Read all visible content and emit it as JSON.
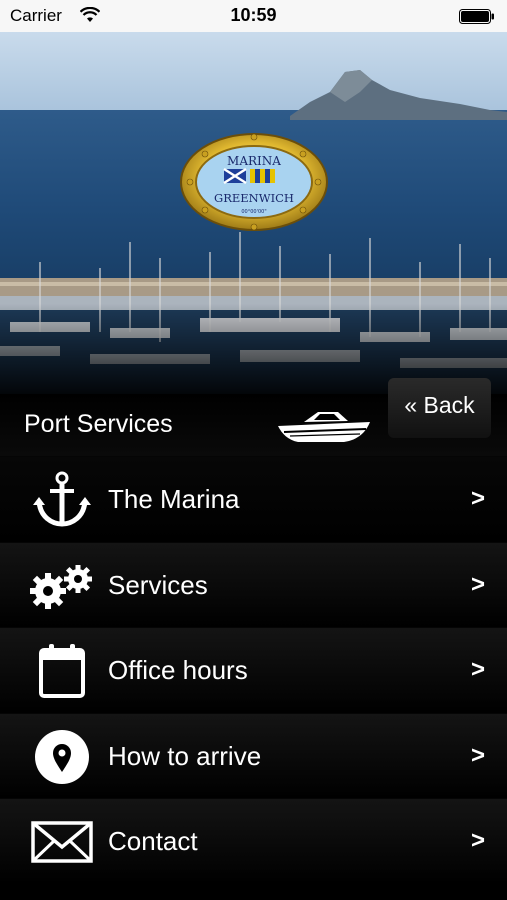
{
  "status_bar": {
    "carrier": "Carrier",
    "time": "10:59"
  },
  "hero": {
    "logo_top_text": "MARINA",
    "logo_bottom_text": "GREENWICH",
    "logo_sub_text": "00°00'00\""
  },
  "header": {
    "title": "Port Services",
    "back_label": "« Back"
  },
  "menu": {
    "items": [
      {
        "label": "The Marina",
        "icon": "anchor-icon"
      },
      {
        "label": "Services",
        "icon": "gears-icon"
      },
      {
        "label": "Office hours",
        "icon": "calendar-icon"
      },
      {
        "label": "How to arrive",
        "icon": "location-pin-icon"
      },
      {
        "label": "Contact",
        "icon": "envelope-icon"
      }
    ],
    "chevron": ">"
  }
}
